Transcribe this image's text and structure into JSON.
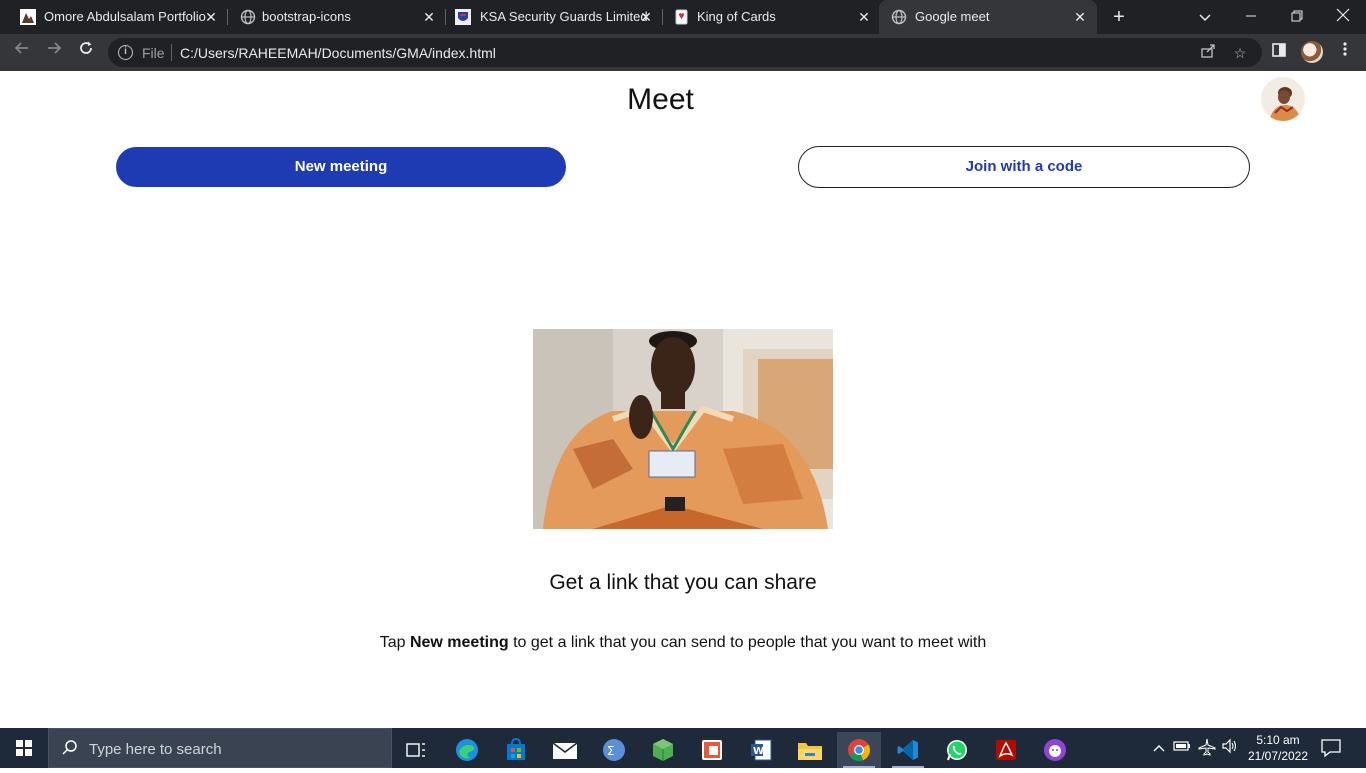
{
  "browser": {
    "tabs": [
      {
        "title": "Omore Abdulsalam Portfolio",
        "favicon": "portfolio-favicon"
      },
      {
        "title": "bootstrap-icons",
        "favicon": "globe-icon"
      },
      {
        "title": "KSA Security Guards Limited",
        "favicon": "ksa-favicon"
      },
      {
        "title": "King of Cards",
        "favicon": "card-favicon"
      },
      {
        "title": "Google meet",
        "favicon": "globe-icon",
        "active": true
      }
    ],
    "address_scheme": "File",
    "address_url": "C:/Users/RAHEEMAH/Documents/GMA/index.html"
  },
  "page": {
    "title": "Meet",
    "new_meeting_label": "New meeting",
    "join_label": "Join with a code",
    "headline": "Get a link that you can share",
    "desc_prefix": "Tap ",
    "desc_bold": "New meeting",
    "desc_suffix": " to get a link that you can send to people that you want to meet with"
  },
  "taskbar": {
    "search_placeholder": "Type here to search",
    "time": "5:10 am",
    "date": "21/07/2022",
    "apps": [
      "task-view-icon",
      "edge-icon",
      "store-icon",
      "mail-icon",
      "calculator-icon",
      "minecraft-icon",
      "office-icon",
      "word-icon",
      "file-explorer-icon",
      "chrome-icon",
      "vscode-icon",
      "whatsapp-icon",
      "acrobat-icon",
      "github-desktop-icon"
    ]
  },
  "colors": {
    "primary_button": "#1f3bb3",
    "browser_frame": "#202124",
    "toolbar": "#35363a",
    "taskbar": "#1e2a3a"
  }
}
